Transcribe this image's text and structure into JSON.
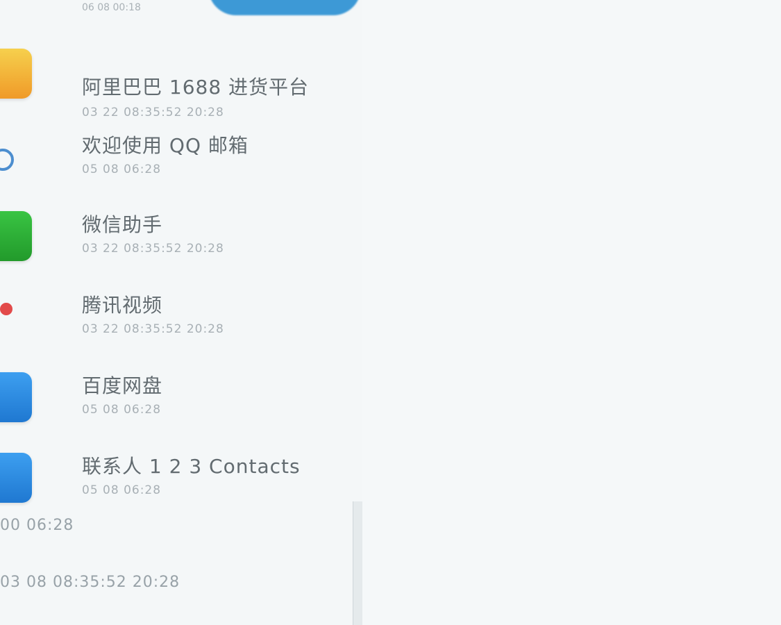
{
  "header": {
    "partial_caption": "06 08 00:18"
  },
  "items": [
    {
      "title": "阿里巴巴 1688 进货平台",
      "subtitle": "03 22 08:35:52 20:28",
      "icon_name": "folder-icon",
      "icon_color": "#f4b43c"
    },
    {
      "title": "欢迎使用 QQ 邮箱",
      "subtitle": "05 08 06:28",
      "icon_name": "mail-icon",
      "icon_color": "#4c8ecf"
    },
    {
      "title": "微信助手",
      "subtitle": "03 22 08:35:52 20:28",
      "icon_name": "chat-icon",
      "icon_color": "#3cba3c"
    },
    {
      "title": "腾讯视频",
      "subtitle": "03 22 08:35:52 20:28",
      "icon_name": "video-icon",
      "icon_color": "#e24a4a"
    },
    {
      "title": "百度网盘",
      "subtitle": "05 08 06:28",
      "icon_name": "cloud-icon",
      "icon_color": "#2d8fe6"
    },
    {
      "title": "联系人 1 2 3 Contacts",
      "subtitle": "05 08 06:28",
      "icon_name": "contacts-icon",
      "icon_color": "#2d8fe6"
    }
  ],
  "footer_lines": [
    "00 06:28",
    "03 08 08:35:52 20:28"
  ],
  "colors": {
    "background": "#f4f7f8",
    "title_text": "#626b70",
    "subtitle_text": "#a8b0b5",
    "accent": "#3d99d6"
  }
}
